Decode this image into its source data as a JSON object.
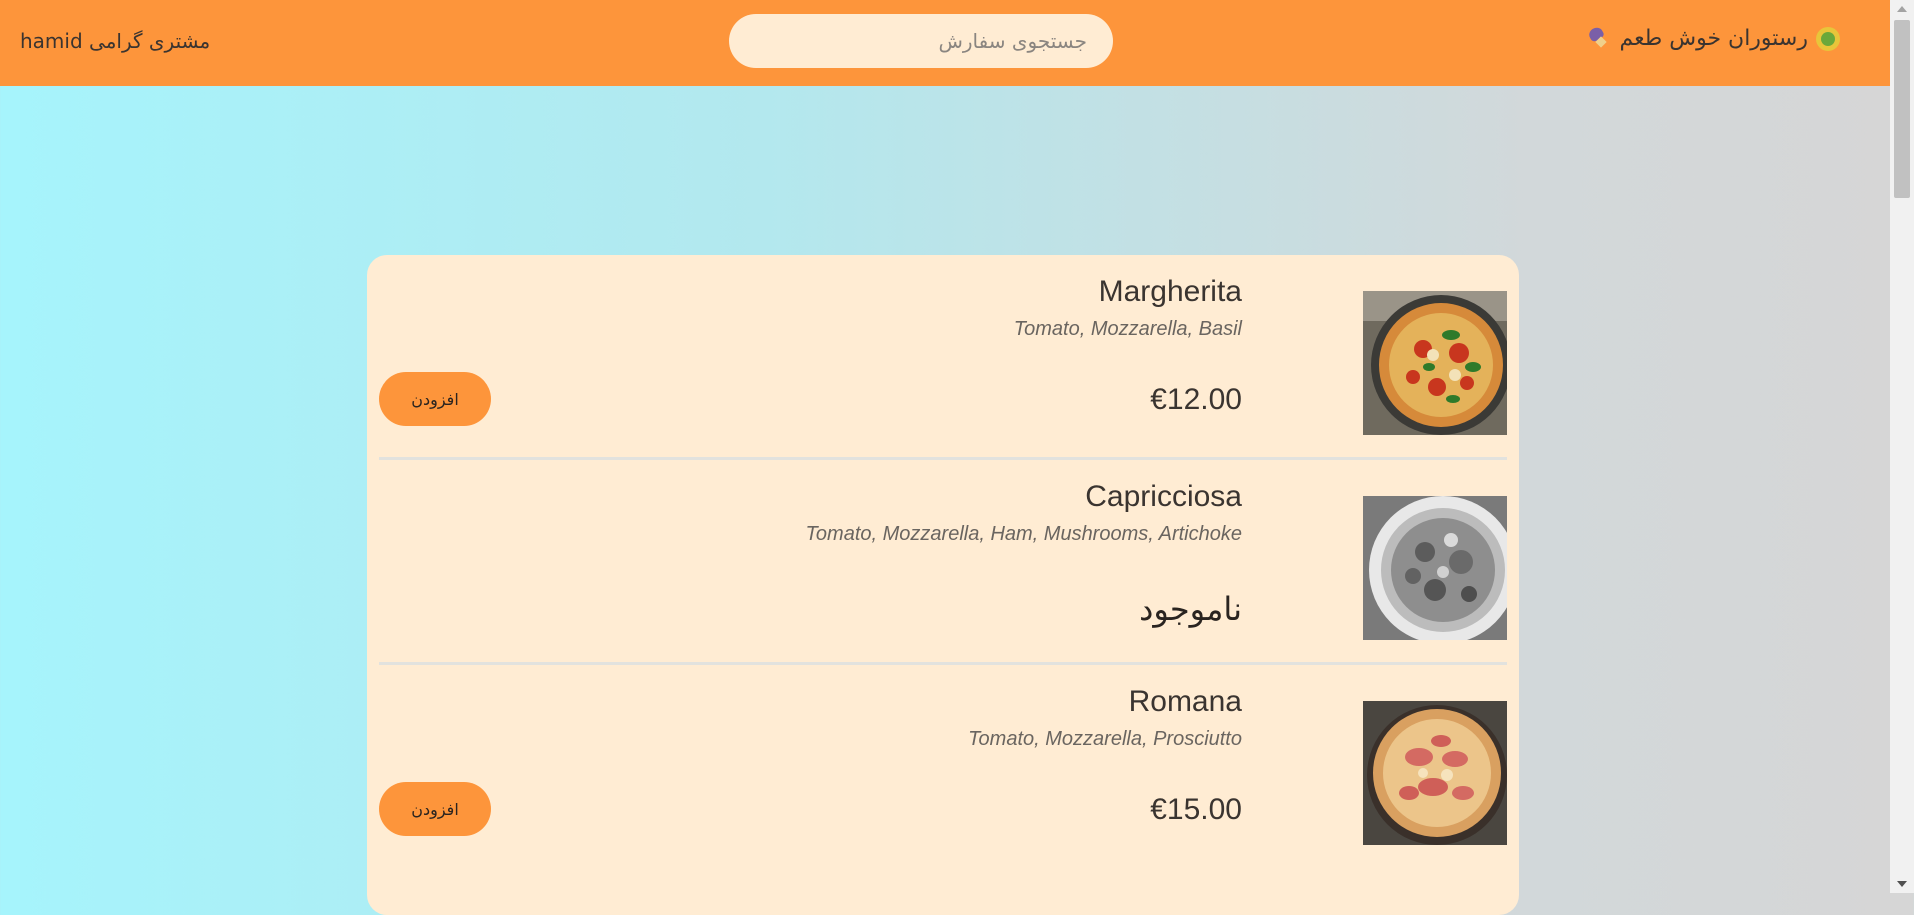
{
  "header": {
    "brand_name": "رستوران خوش طعم",
    "search_placeholder": "جستجوی سفارش",
    "greeting": "مشتری گرامی hamid"
  },
  "colors": {
    "header_bg": "#fd953b",
    "card_bg": "#ffecd3",
    "button_bg": "#fd953b",
    "page_gradient_start": "#a6f4fc",
    "page_gradient_end": "#d6d6d6"
  },
  "menu": {
    "items": [
      {
        "name": "Margherita",
        "ingredients": "Tomato, Mozzarella, Basil",
        "price": "€12.00",
        "available": true,
        "add_label": "افزودن",
        "photo": "pizza-margherita"
      },
      {
        "name": "Capricciosa",
        "ingredients": "Tomato, Mozzarella, Ham, Mushrooms, Artichoke",
        "unavailable_label": "ناموجود",
        "available": false,
        "photo": "pizza-capricciosa-grayscale"
      },
      {
        "name": "Romana",
        "ingredients": "Tomato, Mozzarella, Prosciutto",
        "price": "€15.00",
        "available": true,
        "add_label": "افزودن",
        "photo": "pizza-romana"
      }
    ]
  }
}
